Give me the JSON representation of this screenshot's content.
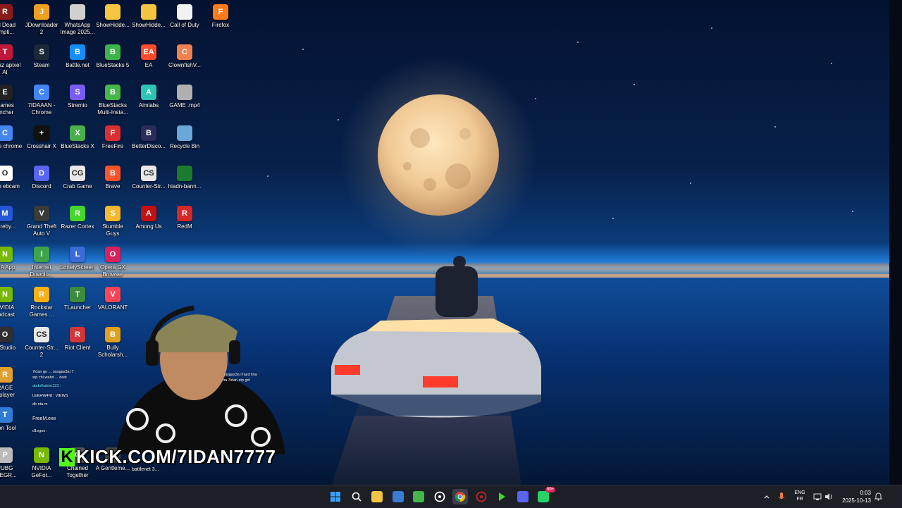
{
  "desktop": {
    "icons": [
      {
        "label": "ad Dead empti...",
        "icon": "red-dead-icon",
        "color": "#8b1a1a",
        "glyph": "R"
      },
      {
        "label": "JDownloader 2",
        "icon": "jdownloader-icon",
        "color": "#f0a020",
        "glyph": "J"
      },
      {
        "label": "WhatsApp Image 2025...",
        "icon": "image-file-icon",
        "color": "#d0d0d0",
        "glyph": ""
      },
      {
        "label": "ShowHidde...",
        "icon": "folder-icon",
        "color": "#f5c542",
        "glyph": ""
      },
      {
        "label": "ShowHidde...",
        "icon": "folder-icon",
        "color": "#f5c542",
        "glyph": ""
      },
      {
        "label": "Call of Duty",
        "icon": "document-icon",
        "color": "#f2f2f2",
        "glyph": ""
      },
      {
        "label": "Firefox",
        "icon": "firefox-icon",
        "color": "#ff7a1a",
        "glyph": "F"
      },
      {
        "label": "Topaz apixel AI",
        "icon": "topaz-icon",
        "color": "#c0183a",
        "glyph": "T"
      },
      {
        "label": "Steam",
        "icon": "steam-icon",
        "color": "#1b2838",
        "glyph": "S"
      },
      {
        "label": "Battle.net",
        "icon": "battlenet-icon",
        "color": "#148eff",
        "glyph": "B"
      },
      {
        "label": "BlueStacks 5",
        "icon": "bluestacks-icon",
        "color": "#3cb44b",
        "glyph": "B"
      },
      {
        "label": "EA",
        "icon": "ea-icon",
        "color": "#ff4b2b",
        "glyph": "EA"
      },
      {
        "label": "ClownfishV...",
        "icon": "clownfish-icon",
        "color": "#f08050",
        "glyph": "C"
      },
      {
        "label": "Games uncher",
        "icon": "epic-games-icon",
        "color": "#222222",
        "glyph": "E"
      },
      {
        "label": "7IDAAAN - Chrome",
        "icon": "chrome-icon",
        "color": "#4285f4",
        "glyph": "C"
      },
      {
        "label": "Stremio",
        "icon": "stremio-icon",
        "color": "#7b5bf5",
        "glyph": "S"
      },
      {
        "label": "BlueStacks Multi-Insta...",
        "icon": "bluestacks-multi-icon",
        "color": "#45b649",
        "glyph": "B"
      },
      {
        "label": "Aimlabs",
        "icon": "aimlabs-icon",
        "color": "#2ec4b6",
        "glyph": "A"
      },
      {
        "label": "GAME .mp4",
        "icon": "video-file-icon",
        "color": "#b0b0b0",
        "glyph": ""
      },
      {
        "label": "oogle chrome",
        "icon": "chrome-icon",
        "color": "#4285f4",
        "glyph": "C"
      },
      {
        "label": "Crosshair X",
        "icon": "crosshair-icon",
        "color": "#111111",
        "glyph": "+"
      },
      {
        "label": "BlueStacks X",
        "icon": "bluestacks-x-icon",
        "color": "#47b04b",
        "glyph": "X"
      },
      {
        "label": "FreeFire",
        "icon": "freefire-icon",
        "color": "#d83030",
        "glyph": "F"
      },
      {
        "label": "BetterDisco...",
        "icon": "betterdiscord-icon",
        "color": "#2a2d5a",
        "glyph": "B"
      },
      {
        "label": "Recycle Bin",
        "icon": "recycle-bin-icon",
        "color": "#6aa8d8",
        "glyph": ""
      },
      {
        "label": "Iriun ebcam",
        "icon": "iriun-icon",
        "color": "#ffffff",
        "glyph": "O"
      },
      {
        "label": "Discord",
        "icon": "discord-icon",
        "color": "#5865f2",
        "glyph": "D"
      },
      {
        "label": "Crab Game",
        "icon": "crab-game-icon",
        "color": "#e9e9e9",
        "glyph": "CG"
      },
      {
        "label": "Brave",
        "icon": "brave-icon",
        "color": "#fb542b",
        "glyph": "B"
      },
      {
        "label": "Counter-Str...",
        "icon": "counter-strike-icon",
        "color": "#e8e8e8",
        "glyph": "CS"
      },
      {
        "label": "hiadn-bann...",
        "icon": "banner-file-icon",
        "color": "#1e7a2e",
        "glyph": ""
      },
      {
        "label": "vareby...",
        "icon": "malwarebytes-icon",
        "color": "#2456d6",
        "glyph": "M"
      },
      {
        "label": "Grand Theft Auto V",
        "icon": "gta-icon",
        "color": "#3a3a3a",
        "glyph": "V"
      },
      {
        "label": "Razer Cortex",
        "icon": "razer-cortex-icon",
        "color": "#44d62c",
        "glyph": "R"
      },
      {
        "label": "Stumble Guys",
        "icon": "stumble-guys-icon",
        "color": "#f5b82e",
        "glyph": "S"
      },
      {
        "label": "Among Us",
        "icon": "among-us-icon",
        "color": "#c51111",
        "glyph": "A"
      },
      {
        "label": "RedM",
        "icon": "redm-icon",
        "color": "#d62828",
        "glyph": "R"
      },
      {
        "label": "DIA App",
        "icon": "nvidia-app-icon",
        "color": "#76b900",
        "glyph": "N"
      },
      {
        "label": "Internet Downlo...",
        "icon": "idm-icon",
        "color": "#3fa34d",
        "glyph": "I"
      },
      {
        "label": "LonelyScreen",
        "icon": "lonelyscreen-icon",
        "color": "#3a6ad6",
        "glyph": "L"
      },
      {
        "label": "Opera GX Browser",
        "icon": "opera-gx-icon",
        "color": "#d8205c",
        "glyph": "O"
      },
      {
        "label": "NVIDIA oadcast",
        "icon": "nvidia-broadcast-icon",
        "color": "#76b900",
        "glyph": "N"
      },
      {
        "label": "Rockstar Games ...",
        "icon": "rockstar-icon",
        "color": "#fcaf17",
        "glyph": "R"
      },
      {
        "label": "TLauncher",
        "icon": "tlauncher-icon",
        "color": "#3d8b3d",
        "glyph": "T"
      },
      {
        "label": "VALORANT",
        "icon": "valorant-icon",
        "color": "#fd4556",
        "glyph": "V"
      },
      {
        "label": "S Studio",
        "icon": "obs-studio-icon",
        "color": "#302e31",
        "glyph": "O"
      },
      {
        "label": "Counter-Str... 2",
        "icon": "counter-strike-2-icon",
        "color": "#e8e8e8",
        "glyph": "CS"
      },
      {
        "label": "Riot Client",
        "icon": "riot-client-icon",
        "color": "#d13639",
        "glyph": "R"
      },
      {
        "label": "Bully Scholarsh...",
        "icon": "bully-icon",
        "color": "#e0a020",
        "glyph": "B"
      },
      {
        "label": "RAGE ltiplayer",
        "icon": "ragemp-icon",
        "color": "#e0a030",
        "glyph": "R"
      },
      {
        "label": "sion Tool",
        "icon": "tool-icon",
        "color": "#2f7bd6",
        "glyph": "T"
      },
      {
        "label": "PUBG TLEGR...",
        "icon": "pubg-icon",
        "color": "#bbbbbb",
        "glyph": "P"
      },
      {
        "label": "NVIDIA GeFor...",
        "icon": "geforce-icon",
        "color": "#76b900",
        "glyph": "N"
      },
      {
        "label": "Chained Together",
        "icon": "chained-together-icon",
        "color": "#555555",
        "glyph": "C"
      },
      {
        "label": "A Gentleme...",
        "icon": "gentleman-icon",
        "color": "#444444",
        "glyph": "A"
      }
    ]
  },
  "overlay": {
    "kick_letter": "K",
    "kick_text": "KICK.COM/7IDAN7777",
    "chat_lines": [
      "7idan go ... ousgas3a i7",
      "stp chi wahd ... dark",
      "abdolhakim123 :",
      "LEEHW4NI : VIEWS",
      "db nta m",
      "d1egoo :",
      "ousgas3a i7ayd lina",
      "ha 7idan stp go!"
    ],
    "partial_labels": [
      "FreeM.exe",
      "battlenet 3..."
    ]
  },
  "taskbar": {
    "apps": [
      {
        "name": "start-button",
        "icon": "windows-logo-icon",
        "color": "#3aa0ff"
      },
      {
        "name": "search-button",
        "icon": "search-icon",
        "color": "#ffffff"
      },
      {
        "name": "taskbar-file-explorer",
        "icon": "folder-icon",
        "color": "#f5c542"
      },
      {
        "name": "taskbar-store",
        "icon": "store-icon",
        "color": "#3a7bd5"
      },
      {
        "name": "taskbar-bluestacks",
        "icon": "bluestacks-icon",
        "color": "#45b649"
      },
      {
        "name": "taskbar-obs",
        "icon": "obs-icon",
        "color": "#ffffff"
      },
      {
        "name": "taskbar-chrome",
        "icon": "chrome-icon",
        "color": "#4285f4"
      },
      {
        "name": "taskbar-crosshair",
        "icon": "crosshair-icon",
        "color": "#cc2222"
      },
      {
        "name": "taskbar-media",
        "icon": "play-icon",
        "color": "#44d62c"
      },
      {
        "name": "taskbar-discord",
        "icon": "discord-icon",
        "color": "#5865f2"
      },
      {
        "name": "taskbar-whatsapp",
        "icon": "whatsapp-icon",
        "color": "#25d366"
      }
    ],
    "whatsapp_badge": "99+",
    "discord_badge": "",
    "lang_line1": "ENG",
    "lang_line2": "FR",
    "time": "0:03",
    "date": "2025-10-13"
  }
}
